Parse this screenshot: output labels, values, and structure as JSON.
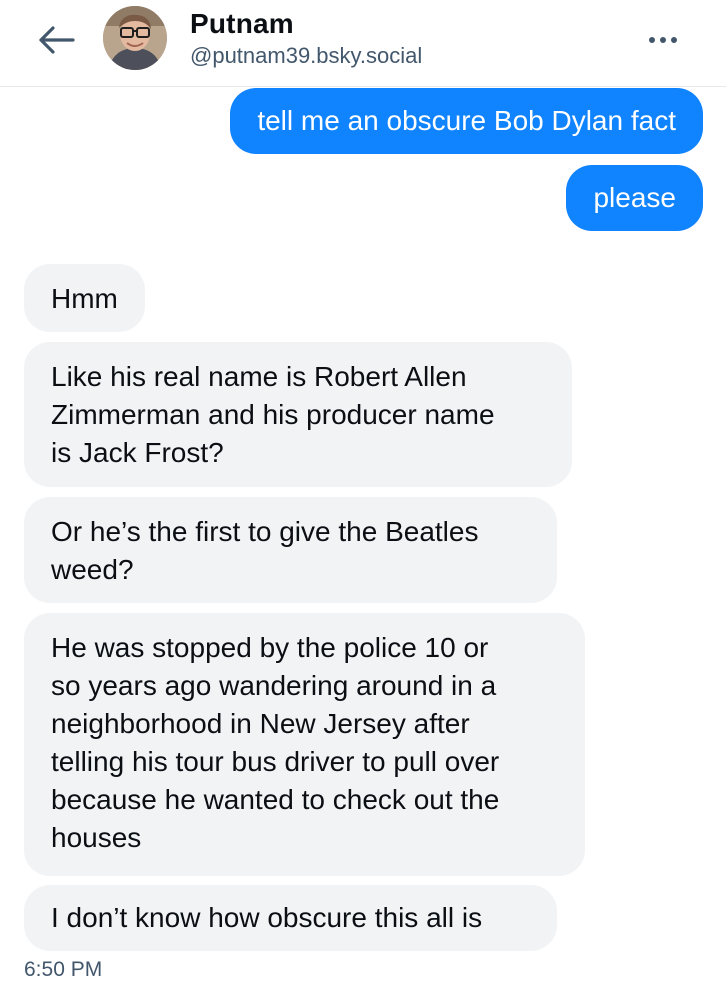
{
  "header": {
    "name": "Putnam",
    "handle": "@putnam39.bsky.social",
    "back_icon": "arrow-left-icon",
    "more_icon": "ellipsis-icon"
  },
  "messages": [
    {
      "sender": "me",
      "text": "tell me an obscure Bob Dylan fact"
    },
    {
      "sender": "me",
      "text": "please"
    },
    {
      "sender": "them",
      "text": "Hmm"
    },
    {
      "sender": "them",
      "text": "Like his real name is Robert Allen\nZimmerman and his producer name\nis Jack Frost?"
    },
    {
      "sender": "them",
      "text": "Or he’s the first to give the Beatles\nweed?"
    },
    {
      "sender": "them",
      "text": "He was stopped by the police 10 or\nso years ago wandering around in a\nneighborhood in New Jersey after\ntelling his tour bus driver to pull over\nbecause he wanted to check out the\nhouses"
    },
    {
      "sender": "them",
      "text": "I don’t know how obscure this all is"
    }
  ],
  "timestamp": "6:50 PM",
  "colors": {
    "sent_bubble": "#1083fe",
    "received_bubble": "#f1f3f5",
    "secondary_text": "#42576c"
  }
}
